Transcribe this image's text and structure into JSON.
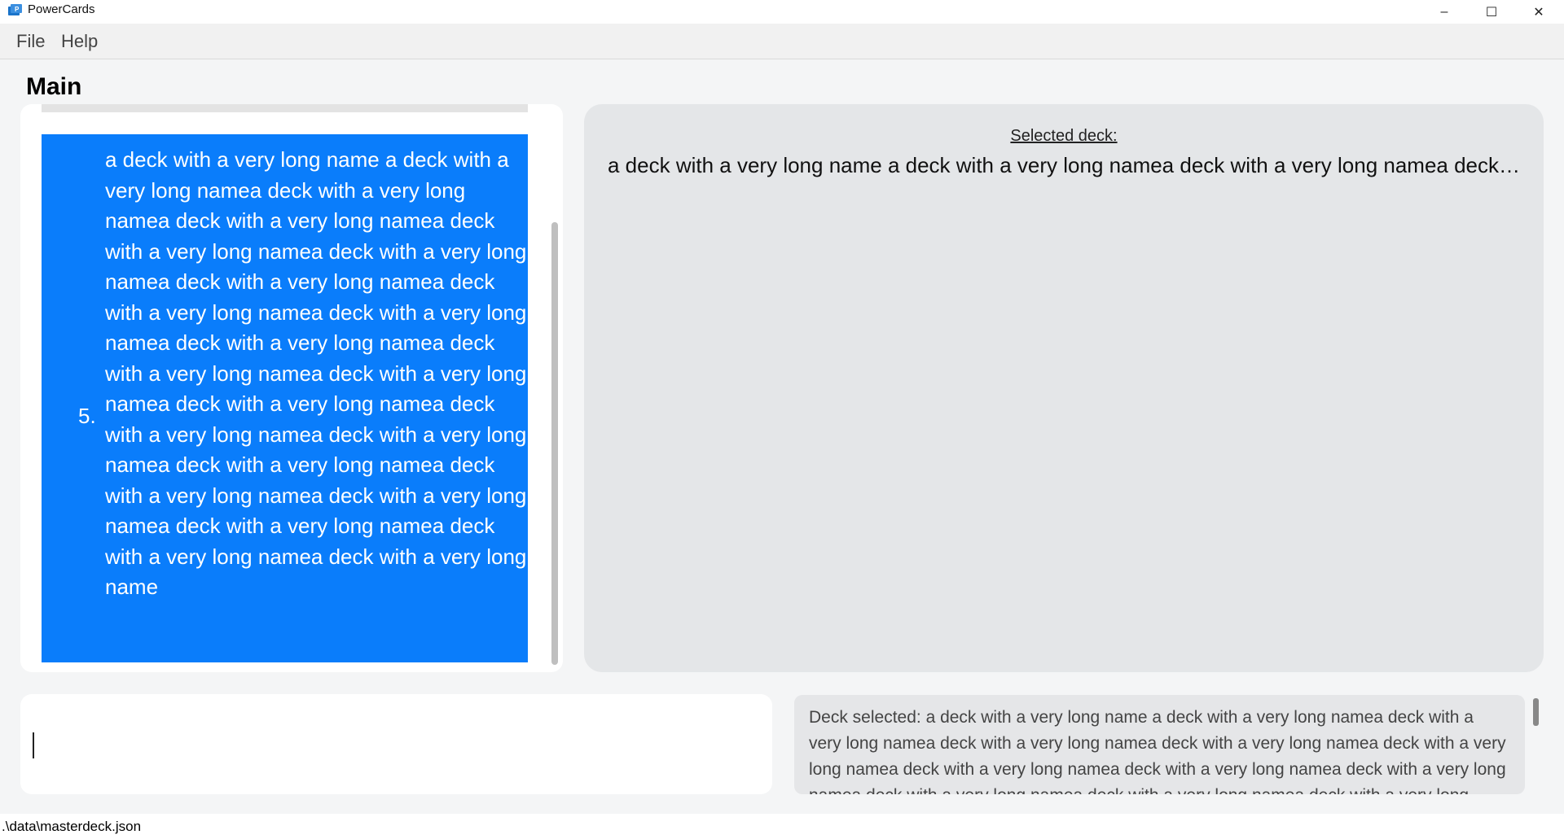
{
  "window": {
    "title": "PowerCards",
    "icon": "app-icon",
    "controls": {
      "minimize": "–",
      "maximize": "☐",
      "close": "✕"
    }
  },
  "menu": {
    "file": "File",
    "help": "Help"
  },
  "page": {
    "title": "Main"
  },
  "deck_list": {
    "items": [
      {
        "index": "5.",
        "name": "a deck with a very long name a deck with a very long namea deck with a very long namea deck with a very long namea deck with a very long namea deck with a very long namea deck with a very long namea deck with a very long namea deck with a very long namea deck with a very long namea deck with a very long namea deck with a very long namea deck with a very long namea deck with a very long namea deck with a very long namea deck with a very long namea deck with a very long namea deck with a very long namea deck with a very long namea deck with a very long namea deck with a very long name",
        "selected": true
      }
    ]
  },
  "selected_deck": {
    "label": "Selected deck:",
    "name": "a deck with a very long name a deck with a very long namea deck with a very long namea deck wi..."
  },
  "command_box": {
    "value": "",
    "placeholder": ""
  },
  "result_display": {
    "text": "Deck selected: a deck with a very long name a deck with a very long namea deck with a very long namea deck with a very long namea deck with a very long namea deck with a very long namea deck with a very long namea deck with a very long namea deck with a very long namea deck with a very long namea deck with a very long namea deck with a very long namea deck with a very long namea"
  },
  "status_bar": {
    "path": ".\\data\\masterdeck.json"
  },
  "colors": {
    "selection": "#0a7dfb",
    "panel": "#e4e6e8",
    "background": "#f4f5f6"
  }
}
